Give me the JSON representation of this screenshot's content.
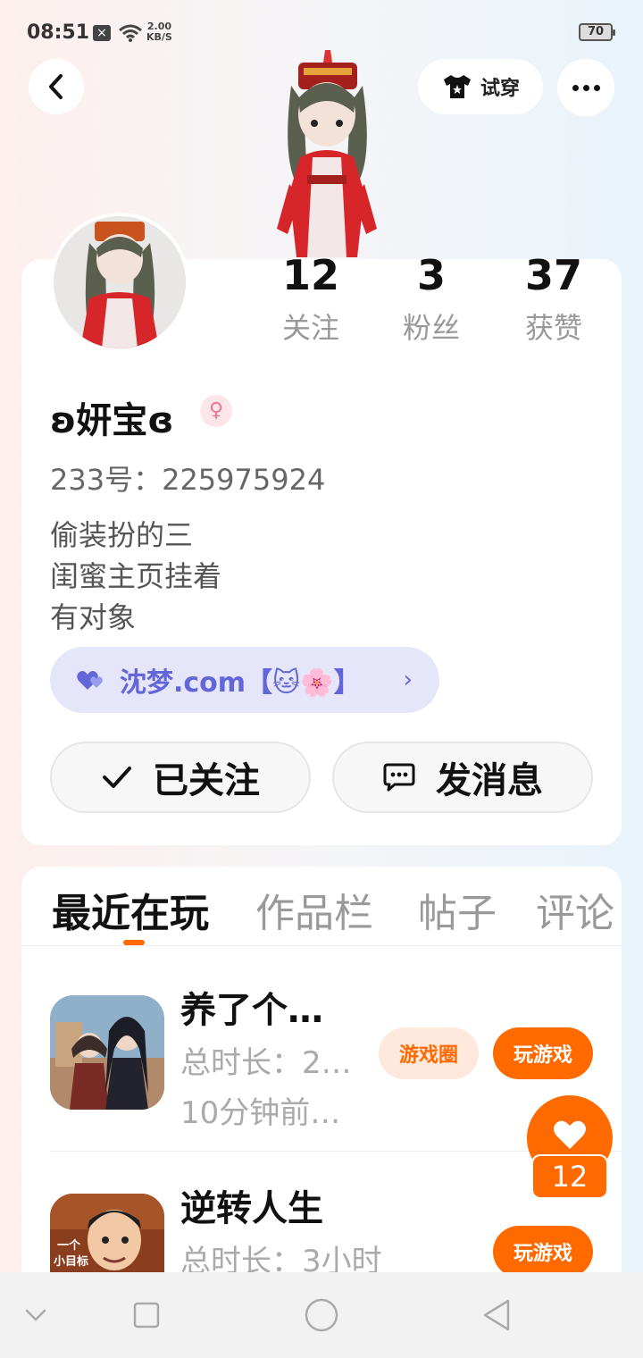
{
  "status_bar": {
    "time": "08:51",
    "net_speed_value": "2.00",
    "net_speed_unit": "KB/S",
    "battery": "70"
  },
  "header": {
    "try_on_label": "试穿"
  },
  "stats": [
    {
      "value": "12",
      "label": "关注"
    },
    {
      "value": "3",
      "label": "粉丝"
    },
    {
      "value": "37",
      "label": "获赞"
    }
  ],
  "profile": {
    "nickname": "ʚ妍宝ɞ",
    "gender_icon": "female-icon",
    "uid": "233号：225975924",
    "bio": [
      "偷装扮的三",
      "闺蜜主页挂着",
      "有对象"
    ],
    "pill_label": "沈梦.com【🐱🌸】"
  },
  "actions": {
    "following_label": "已关注",
    "message_label": "发消息"
  },
  "tabs": [
    "最近在玩",
    "作品栏",
    "帖子",
    "评论"
  ],
  "games": [
    {
      "title": "养了个…",
      "duration": "总时长：2…",
      "last_played": "10分钟前…",
      "circle_label": "游戏圈",
      "play_label": "玩游戏"
    },
    {
      "title": "逆转人生",
      "duration": "总时长：3小时",
      "play_label": "玩游戏",
      "icon_text_1": "一个",
      "icon_text_2": "小目标"
    }
  ],
  "like_count": "12",
  "colors": {
    "accent": "#ff6a00",
    "pill_bg": "#e6e6fb",
    "pill_text": "#6366d8"
  }
}
